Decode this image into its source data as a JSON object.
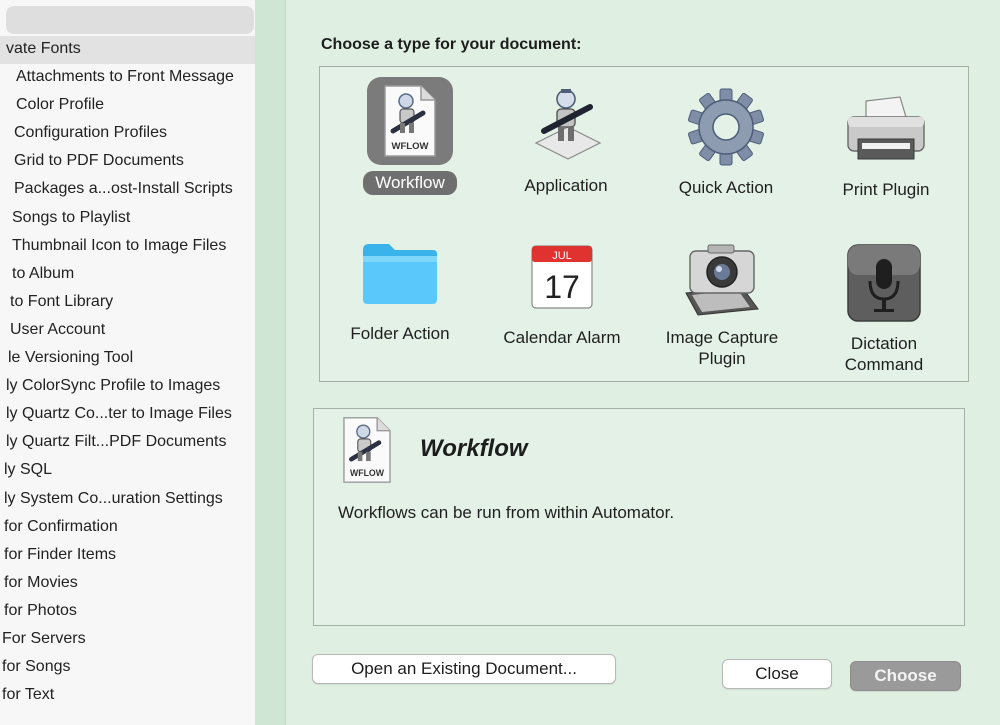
{
  "sidebar": {
    "items": [
      "vate Fonts",
      "Attachments to Front Message",
      "Color Profile",
      "Configuration Profiles",
      "Grid to PDF Documents",
      "Packages a...ost-Install Scripts",
      "Songs to Playlist",
      "Thumbnail Icon to Image Files",
      "to Album",
      "to Font Library",
      "User Account",
      "le Versioning Tool",
      "ly ColorSync Profile to Images",
      "ly Quartz Co...ter to Image Files",
      "ly Quartz Filt...PDF Documents",
      "ly SQL",
      "ly System Co...uration Settings",
      "for Confirmation",
      "for Finder Items",
      "for Movies",
      "for Photos",
      "For Servers",
      "for Songs",
      "for Text"
    ]
  },
  "dialog": {
    "title": "Choose a type for your document:",
    "types": [
      {
        "label": "Workflow",
        "icon": "workflow-icon",
        "selected": true
      },
      {
        "label": "Application",
        "icon": "automator-robot-icon",
        "selected": false
      },
      {
        "label": "Quick Action",
        "icon": "gear-icon",
        "selected": false
      },
      {
        "label": "Print Plugin",
        "icon": "printer-icon",
        "selected": false
      },
      {
        "label": "Folder Action",
        "icon": "folder-icon",
        "selected": false
      },
      {
        "label": "Calendar Alarm",
        "icon": "calendar-icon",
        "selected": false
      },
      {
        "label": "Image Capture\nPlugin",
        "icon": "camera-icon",
        "selected": false
      },
      {
        "label": "Dictation\nCommand",
        "icon": "microphone-icon",
        "selected": false
      }
    ],
    "icon_text": {
      "wflow": "WFLOW",
      "cal_month": "JUL",
      "cal_day": "17"
    },
    "description": {
      "title": "Workflow",
      "text": "Workflows can be run from within Automator."
    },
    "buttons": {
      "open": "Open an Existing Document...",
      "close": "Close",
      "choose": "Choose"
    }
  },
  "colors": {
    "sheet": "#dff0e2",
    "selected_bg": "#6f6f6f",
    "folder": "#5ac8fa",
    "calendar_red": "#e0332f"
  }
}
